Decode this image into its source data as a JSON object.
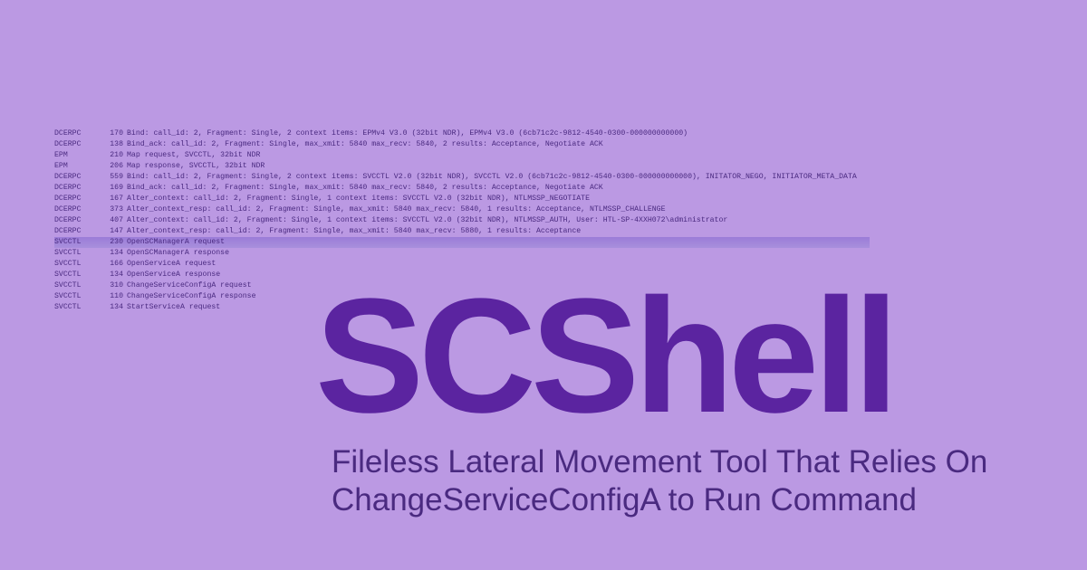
{
  "log": {
    "rows": [
      {
        "proto": "DCERPC",
        "len": "170",
        "info": "Bind: call_id: 2, Fragment: Single, 2 context items: EPMv4 V3.0 (32bit NDR), EPMv4 V3.0 (6cb71c2c-9812-4540-0300-000000000000)",
        "hl": false
      },
      {
        "proto": "DCERPC",
        "len": "138",
        "info": "Bind_ack: call_id: 2, Fragment: Single, max_xmit: 5840 max_recv: 5840, 2 results: Acceptance, Negotiate ACK",
        "hl": false
      },
      {
        "proto": "EPM",
        "len": "210",
        "info": "Map request, SVCCTL, 32bit NDR",
        "hl": false
      },
      {
        "proto": "EPM",
        "len": "206",
        "info": "Map response, SVCCTL, 32bit NDR",
        "hl": false
      },
      {
        "proto": "DCERPC",
        "len": "559",
        "info": "Bind: call_id: 2, Fragment: Single, 2 context items: SVCCTL V2.0 (32bit NDR), SVCCTL V2.0 (6cb71c2c-9812-4540-0300-000000000000), INITATOR_NEGO, INITIATOR_META_DATA",
        "hl": false
      },
      {
        "proto": "DCERPC",
        "len": "169",
        "info": "Bind_ack: call_id: 2, Fragment: Single, max_xmit: 5840 max_recv: 5840, 2 results: Acceptance, Negotiate ACK",
        "hl": false
      },
      {
        "proto": "DCERPC",
        "len": "167",
        "info": "Alter_context: call_id: 2, Fragment: Single, 1 context items: SVCCTL V2.0 (32bit NDR), NTLMSSP_NEGOTIATE",
        "hl": false
      },
      {
        "proto": "DCERPC",
        "len": "373",
        "info": "Alter_context_resp: call_id: 2, Fragment: Single, max_xmit: 5840 max_recv: 5840, 1 results: Acceptance, NTLMSSP_CHALLENGE",
        "hl": false
      },
      {
        "proto": "DCERPC",
        "len": "407",
        "info": "Alter_context: call_id: 2, Fragment: Single, 1 context items: SVCCTL V2.0 (32bit NDR), NTLMSSP_AUTH, User: HTL-SP-4XXH072\\administrator",
        "hl": false
      },
      {
        "proto": "DCERPC",
        "len": "147",
        "info": "Alter_context_resp: call_id: 2, Fragment: Single, max_xmit: 5840 max_recv: 5880, 1 results: Acceptance",
        "hl": false
      },
      {
        "proto": "SVCCTL",
        "len": "230",
        "info": "OpenSCManagerA request",
        "hl": true
      },
      {
        "proto": "SVCCTL",
        "len": "134",
        "info": "OpenSCManagerA response",
        "hl": false
      },
      {
        "proto": "SVCCTL",
        "len": "166",
        "info": "OpenServiceA request",
        "hl": false
      },
      {
        "proto": "SVCCTL",
        "len": "134",
        "info": "OpenServiceA response",
        "hl": false
      },
      {
        "proto": "SVCCTL",
        "len": "310",
        "info": "ChangeServiceConfigA request",
        "hl": false
      },
      {
        "proto": "SVCCTL",
        "len": "110",
        "info": "ChangeServiceConfigA response",
        "hl": false
      },
      {
        "proto": "SVCCTL",
        "len": "134",
        "info": "StartServiceA request",
        "hl": false
      }
    ]
  },
  "headline": {
    "title": "SCShell",
    "subtitle_line1": "Fileless Lateral Movement Tool That Relies On",
    "subtitle_line2": "ChangeServiceConfigA to Run Command"
  }
}
